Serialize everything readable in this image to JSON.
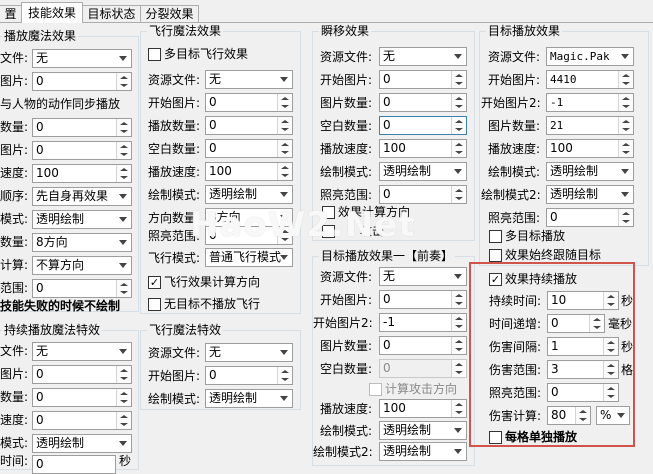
{
  "tabs": [
    "置",
    "技能效果",
    "目标状态",
    "分裂效果"
  ],
  "col1": {
    "group1_title": "播放魔法效果",
    "l_file": "文件:",
    "v_file": "无",
    "l_pic": "图片:",
    "v_pic": "0",
    "l_sync": "与人物的动作同步播放",
    "l_count": "数量:",
    "v_count": "0",
    "l_pic2": "图片:",
    "v_pic2": "0",
    "l_speed": "速度:",
    "v_speed": "100",
    "l_order": "顺序:",
    "v_order": "先自身再效果",
    "l_mode": "模式:",
    "v_mode": "透明绘制",
    "l_dircount": "数量:",
    "v_dircount": "8方向",
    "l_calc": "计算:",
    "v_calc": "不算方向",
    "l_range": "范围:",
    "v_range": "0",
    "fail_text": "技能失败的时候不绘制",
    "group2_title": "持续播放魔法特效",
    "l2_file": "文件:",
    "v2_file": "无",
    "l2_pic": "图片:",
    "v2_pic": "0",
    "l2_count": "数量:",
    "v2_count": "0",
    "l2_speed": "速度:",
    "v2_speed": "0",
    "l2_mode": "模式:",
    "v2_mode": "透明绘制",
    "l2_last": "时间:",
    "v2_last": "0",
    "v2_last_unit": "秒"
  },
  "col2": {
    "group1_title": "飞行魔法效果",
    "multi_target": "多目标飞行效果",
    "l_file": "资源文件:",
    "v_file": "无",
    "l_start": "开始图片:",
    "v_start": "0",
    "l_count": "播放数量:",
    "v_count": "0",
    "l_blank": "空白数量:",
    "v_blank": "0",
    "l_speed": "播放速度:",
    "v_speed": "100",
    "l_mode": "绘制模式:",
    "v_mode": "透明绘制",
    "l_dir": "方向数量:",
    "v_dir": "8方向",
    "l_light": "照亮范围:",
    "v_light": "0",
    "l_fly": "飞行模式:",
    "v_fly": "普通飞行模式",
    "calc_dir": "飞行效果计算方向",
    "no_target": "无目标不播放飞行",
    "group2_title": "飞行魔法特效",
    "l2_file": "资源文件:",
    "v2_file": "无",
    "l2_start": "开始图片:",
    "v2_start": "0",
    "l2_mode": "绘制模式:",
    "v2_mode": "透明绘制"
  },
  "col3": {
    "group1_title": "瞬移效果",
    "l_file": "资源文件:",
    "v_file": "无",
    "l_start": "开始图片:",
    "v_start": "0",
    "l_pics": "图片数量:",
    "v_pics": "0",
    "l_blank": "空白数量:",
    "v_blank": "0",
    "l_speed": "播放速度:",
    "v_speed": "100",
    "l_mode": "绘制模式:",
    "v_mode": "透明绘制",
    "l_light": "照亮范围:",
    "v_light": "0",
    "calc_dir": "效果计算方向",
    "hit_text": "攻击",
    "group2_title": "目标播放效果一【前奏】",
    "l2_file": "资源文件:",
    "v2_file": "无",
    "l2_start": "开始图片:",
    "v2_start": "0",
    "l2_start2": "开始图片2:",
    "v2_start2": "-1",
    "l2_pics": "图片数量:",
    "v2_pics": "0",
    "l2_blank": "空白数量:",
    "v2_blank": "0",
    "calc_attack": "计算攻击方向",
    "l2_speed": "播放速度:",
    "v2_speed": "100",
    "l2_mode": "绘制模式:",
    "v2_mode": "透明绘制",
    "l2_mode2": "绘制模式2:",
    "v2_mode2": "透明绘制"
  },
  "col4": {
    "group_title": "目标播放效果",
    "l_file": "资源文件:",
    "v_file": "Magic.Pak",
    "l_start": "开始图片:",
    "v_start": "4410",
    "l_start2": "开始图片2:",
    "v_start2": "-1",
    "l_pics": "图片数量:",
    "v_pics": "21",
    "l_speed": "播放速度:",
    "v_speed": "100",
    "l_mode": "绘制模式:",
    "v_mode": "透明绘制",
    "l_mode2": "绘制模式2:",
    "v_mode2": "透明绘制",
    "l_light": "照亮范围:",
    "v_light": "0",
    "multi_target": "多目标播放",
    "follow": "效果始终跟随目标",
    "sustain": "效果持续播放",
    "l_dur": "持续时间:",
    "v_dur": "10",
    "u_dur": "秒",
    "l_inc": "时间递增:",
    "v_inc": "0",
    "u_inc": "毫秒",
    "l_int": "伤害间隔:",
    "v_int": "1",
    "u_int": "秒",
    "l_dmgr": "伤害范围:",
    "v_dmgr": "3",
    "u_dmgr": "格",
    "l_light2": "照亮范围:",
    "v_light2": "0",
    "l_calc": "伤害计算:",
    "v_calc": "80",
    "v_calc_unit": "%",
    "single": "每格单独播放"
  },
  "watermark": "HaoW2.Net"
}
